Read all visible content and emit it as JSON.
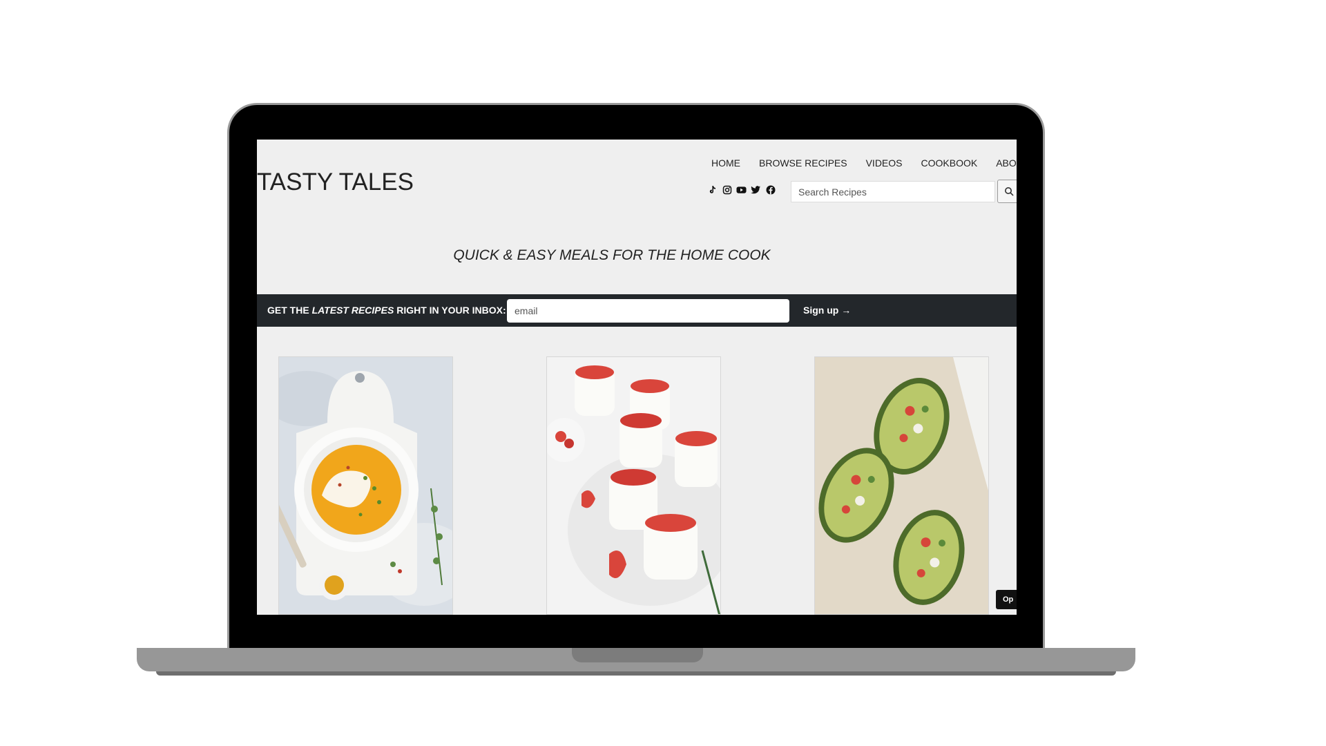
{
  "site": {
    "logo": "TASTY TALES",
    "tagline": "QUICK & EASY MEALS FOR THE HOME COOK"
  },
  "nav": {
    "items": [
      "HOME",
      "BROWSE RECIPES",
      "VIDEOS",
      "COOKBOOK",
      "ABOUT"
    ]
  },
  "social": {
    "icons": [
      "tiktok-icon",
      "instagram-icon",
      "youtube-icon",
      "twitter-icon",
      "facebook-icon"
    ]
  },
  "search": {
    "placeholder": "Search Recipes",
    "button_icon": "search-icon"
  },
  "newsletter": {
    "label_before": "GET THE ",
    "label_emphasis": "LATEST RECIPES",
    "label_after": " RIGHT IN YOUR INBOX:",
    "email_placeholder": "email",
    "button_label": "Sign up →"
  },
  "cards": [
    {
      "image": "butternut-squash-soup-photo"
    },
    {
      "image": "strawberry-panna-cotta-photo"
    },
    {
      "image": "stuffed-avocado-photo"
    }
  ],
  "badge": {
    "label": "Op"
  },
  "colors": {
    "page_bg": "#efefef",
    "signup_bar": "#23272b",
    "text": "#222222"
  }
}
